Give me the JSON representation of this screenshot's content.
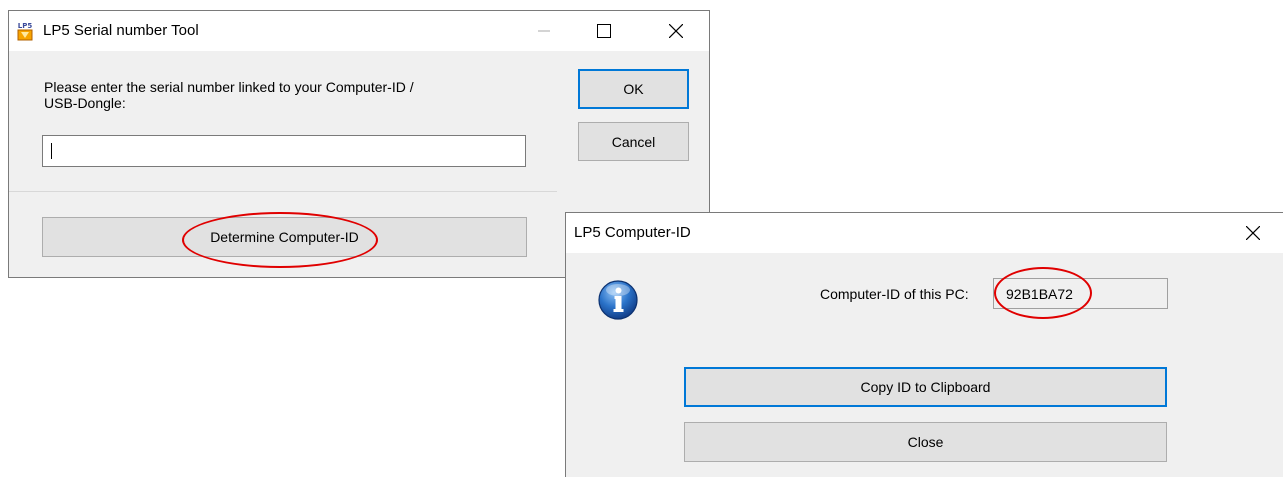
{
  "serial_dialog": {
    "title": "LP5 Serial number Tool",
    "app_icon_text": "LP5",
    "prompt_line1": "Please enter the serial number linked to your Computer-ID /",
    "prompt_line2": "USB-Dongle:",
    "serial_input": {
      "value": "",
      "placeholder": ""
    },
    "ok_label": "OK",
    "cancel_label": "Cancel",
    "determine_label": "Determine Computer-ID"
  },
  "computer_id_dialog": {
    "title": "LP5 Computer-ID",
    "id_label": "Computer-ID of this PC:",
    "id_value": "92B1BA72",
    "copy_label": "Copy ID to Clipboard",
    "close_label": "Close"
  },
  "colors": {
    "highlight_ellipse": "#e00000",
    "default_button_border": "#0078d7",
    "dialog_background": "#f0f0f0"
  }
}
